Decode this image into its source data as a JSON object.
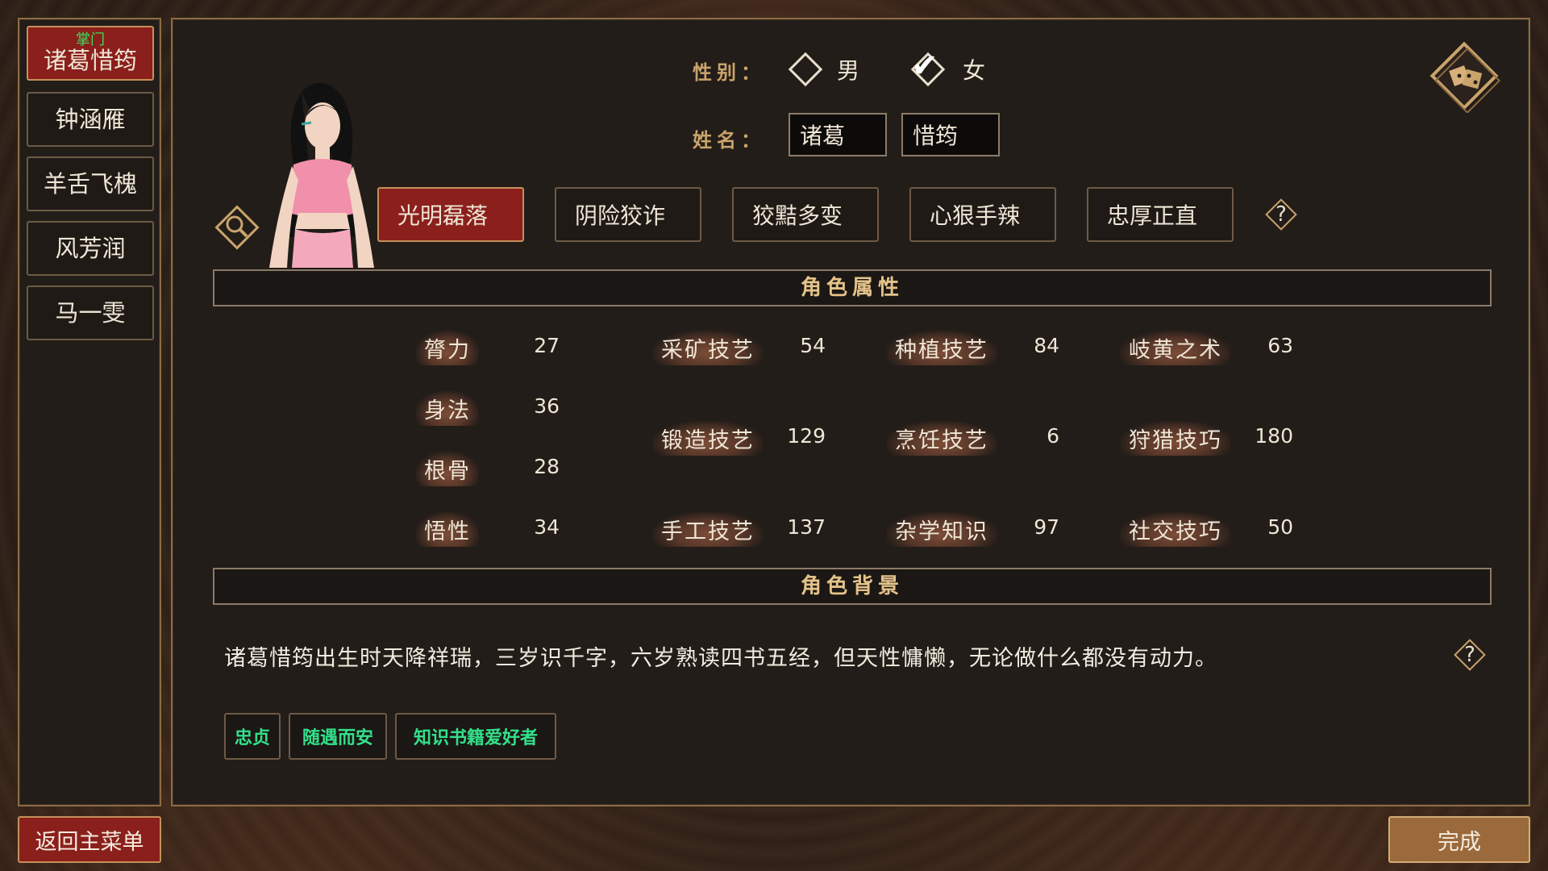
{
  "sidebar": {
    "characters": [
      {
        "role": "掌门",
        "name": "诸葛惜筠",
        "active": true
      },
      {
        "role": "",
        "name": "钟涵雁",
        "active": false
      },
      {
        "role": "",
        "name": "羊舌飞槐",
        "active": false
      },
      {
        "role": "",
        "name": "风芳润",
        "active": false
      },
      {
        "role": "",
        "name": "马一雯",
        "active": false
      }
    ]
  },
  "form": {
    "gender_label": "性别：",
    "male": "男",
    "female": "女",
    "selected_gender": "女",
    "name_label": "姓名：",
    "surname": "诸葛",
    "given_name": "惜筠"
  },
  "traits": [
    {
      "label": "光明磊落",
      "active": true
    },
    {
      "label": "阴险狡诈",
      "active": false
    },
    {
      "label": "狡黠多变",
      "active": false
    },
    {
      "label": "心狠手辣",
      "active": false
    },
    {
      "label": "忠厚正直",
      "active": false
    }
  ],
  "attributes": {
    "title": "角色属性",
    "base": [
      {
        "label": "膂力",
        "value": "27"
      },
      {
        "label": "身法",
        "value": "36"
      },
      {
        "label": "根骨",
        "value": "28"
      },
      {
        "label": "悟性",
        "value": "34"
      }
    ],
    "skills": [
      {
        "label": "采矿技艺",
        "value": "54"
      },
      {
        "label": "种植技艺",
        "value": "84"
      },
      {
        "label": "岐黄之术",
        "value": "63"
      },
      {
        "label": "锻造技艺",
        "value": "129"
      },
      {
        "label": "烹饪技艺",
        "value": "6"
      },
      {
        "label": "狩猎技巧",
        "value": "180"
      },
      {
        "label": "手工技艺",
        "value": "137"
      },
      {
        "label": "杂学知识",
        "value": "97"
      },
      {
        "label": "社交技巧",
        "value": "50"
      }
    ]
  },
  "background": {
    "title": "角色背景",
    "text": "诸葛惜筠出生时天降祥瑞，三岁识千字，六岁熟读四书五经，但天性慵懒，无论做什么都没有动力。",
    "tags": [
      "忠贞",
      "随遇而安",
      "知识书籍爱好者"
    ]
  },
  "buttons": {
    "back": "返回主菜单",
    "done": "完成"
  },
  "icons": {
    "help": "?",
    "dice": "dice-icon",
    "inspect": "magnifier-icon"
  },
  "colors": {
    "accent_red": "#8b1f1c",
    "gold": "#c9a46b",
    "tag_green": "#33e08a"
  }
}
